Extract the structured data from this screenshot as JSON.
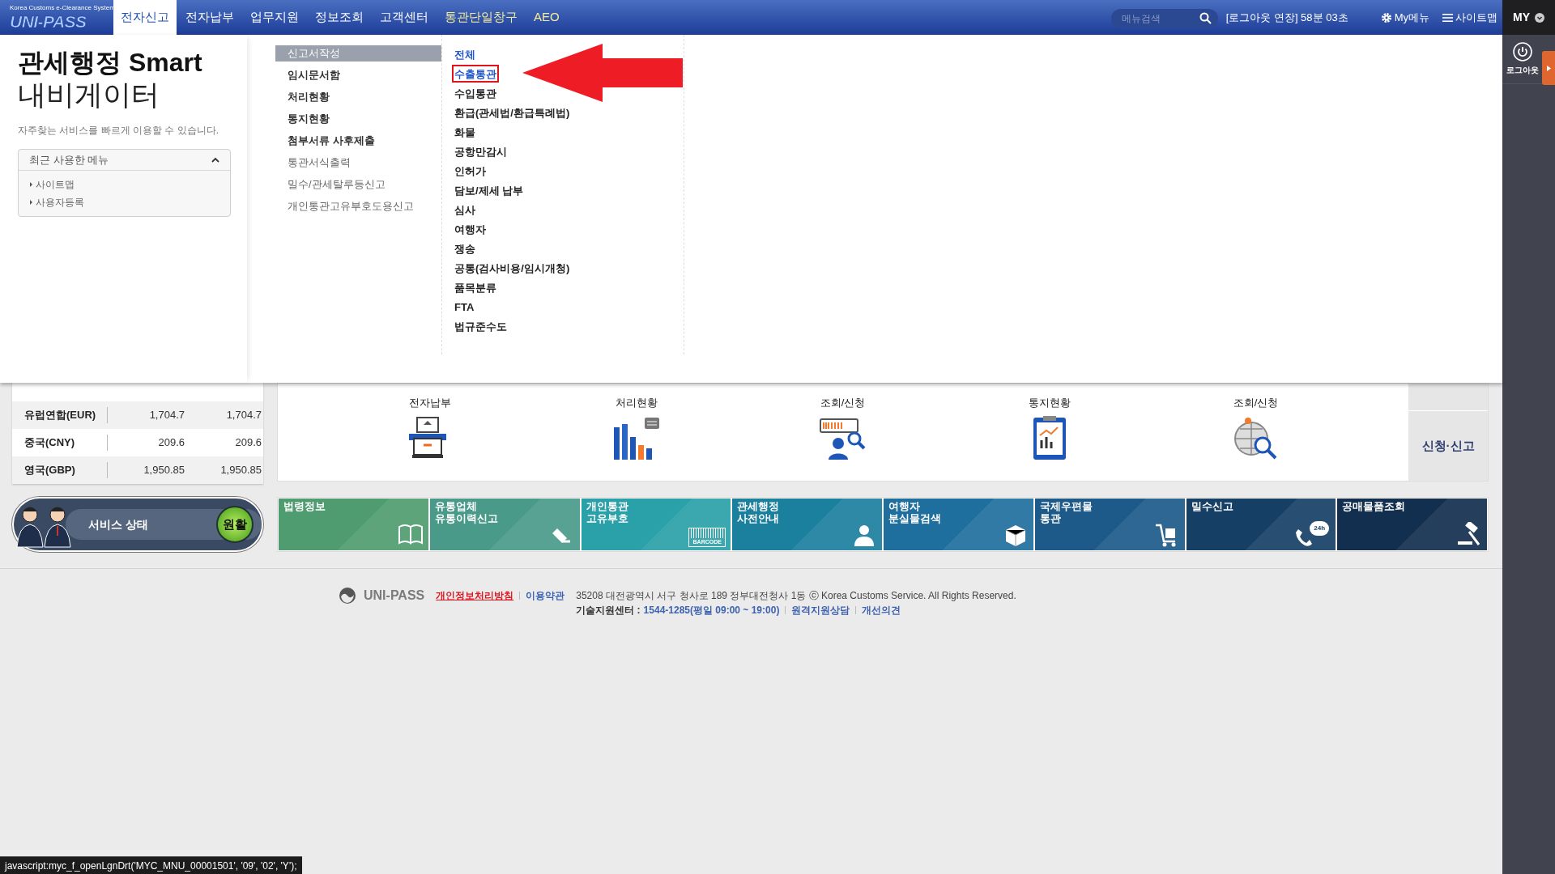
{
  "header": {
    "logo_tagline": "Korea Customs e-Clearance System",
    "logo": "UNI-PASS",
    "tabs": [
      {
        "label": "전자신고",
        "selected": true,
        "kind": "normal"
      },
      {
        "label": "전자납부",
        "selected": false,
        "kind": "normal"
      },
      {
        "label": "업무지원",
        "selected": false,
        "kind": "normal"
      },
      {
        "label": "정보조회",
        "selected": false,
        "kind": "normal"
      },
      {
        "label": "고객센터",
        "selected": false,
        "kind": "normal"
      },
      {
        "label": "통관단일창구",
        "selected": false,
        "kind": "highlight"
      },
      {
        "label": "AEO",
        "selected": false,
        "kind": "highlight"
      }
    ],
    "search": {
      "placeholder": "메뉴검색"
    },
    "session": "[로그아웃 연장] 58분 03초",
    "links": [
      {
        "label": "My메뉴",
        "kind": "gear"
      },
      {
        "label": "사이트맵",
        "kind": "menu"
      }
    ]
  },
  "right_rail": {
    "my": "MY",
    "logout": "로그아웃"
  },
  "navigator": {
    "title_bold": "관세행정 Smart",
    "title": "내비게이터",
    "description": "자주찾는 서비스를 빠르게 이용할 수 있습니다.",
    "recent": {
      "title": "최근 사용한 메뉴",
      "expanded": true,
      "items": [
        "사이트맵",
        "사용자등록"
      ]
    }
  },
  "menu": {
    "items": [
      {
        "label": "신고서작성",
        "selected": true,
        "emphasized": false
      },
      {
        "label": "임시문서함",
        "selected": false,
        "emphasized": true
      },
      {
        "label": "처리현황",
        "selected": false,
        "emphasized": true
      },
      {
        "label": "통지현황",
        "selected": false,
        "emphasized": true
      },
      {
        "label": "첨부서류 사후제출",
        "selected": false,
        "emphasized": true
      },
      {
        "label": "통관서식출력",
        "selected": false,
        "emphasized": false
      },
      {
        "label": "밀수/관세탈루등신고",
        "selected": false,
        "emphasized": false
      },
      {
        "label": "개인통관고유부호도용신고",
        "selected": false,
        "emphasized": false
      }
    ],
    "submenu": [
      {
        "label": "전체",
        "highlighted": true,
        "annotated": false
      },
      {
        "label": "수출통관",
        "highlighted": true,
        "annotated": true
      },
      {
        "label": "수입통관",
        "highlighted": false,
        "annotated": false
      },
      {
        "label": "환급(관세법/환급특례법)",
        "highlighted": false,
        "annotated": false
      },
      {
        "label": "화물",
        "highlighted": false,
        "annotated": false
      },
      {
        "label": "공항만감시",
        "highlighted": false,
        "annotated": false
      },
      {
        "label": "인허가",
        "highlighted": false,
        "annotated": false
      },
      {
        "label": "담보/제세 납부",
        "highlighted": false,
        "annotated": false
      },
      {
        "label": "심사",
        "highlighted": false,
        "annotated": false
      },
      {
        "label": "여행자",
        "highlighted": false,
        "annotated": false
      },
      {
        "label": "쟁송",
        "highlighted": false,
        "annotated": false
      },
      {
        "label": "공통(검사비용/임시개청)",
        "highlighted": false,
        "annotated": false
      },
      {
        "label": "품목분류",
        "highlighted": false,
        "annotated": false
      },
      {
        "label": "FTA",
        "highlighted": false,
        "annotated": false
      },
      {
        "label": "법규준수도",
        "highlighted": false,
        "annotated": false
      }
    ]
  },
  "exchange_rates": [
    {
      "currency": "유럽연합(EUR)",
      "values": [
        "1,704.7",
        "1,704.7"
      ]
    },
    {
      "currency": "중국(CNY)",
      "values": [
        "209.6",
        "209.6"
      ]
    },
    {
      "currency": "영국(GBP)",
      "values": [
        "1,950.85",
        "1,950.85"
      ]
    }
  ],
  "service_status": {
    "label": "서비스 상태",
    "status": "원활"
  },
  "quick_services": [
    {
      "label": "전자납부",
      "kind": "payment"
    },
    {
      "label": "처리현황",
      "kind": "chart"
    },
    {
      "label": "조회/신청",
      "kind": "barcode"
    },
    {
      "label": "통지현황",
      "kind": "report"
    },
    {
      "label": "조회/신청",
      "kind": "globe"
    }
  ],
  "side_tab": "신청·신고",
  "tiles": [
    {
      "lines": [
        "법령정보"
      ],
      "color": "#4f9c70",
      "kind": "book"
    },
    {
      "lines": [
        "유통업체",
        "유통이력신고"
      ],
      "color": "#4a9a8a",
      "kind": "pen"
    },
    {
      "lines": [
        "개인통관",
        "고유부호"
      ],
      "color": "#2aa0a8",
      "kind": "barcode"
    },
    {
      "lines": [
        "관세행정",
        "사전안내"
      ],
      "color": "#1b7f9e",
      "kind": "person"
    },
    {
      "lines": [
        "여행자",
        "분실물검색"
      ],
      "color": "#1f6f9e",
      "kind": "box"
    },
    {
      "lines": [
        "국제우편물",
        "통관"
      ],
      "color": "#1d5a8a",
      "kind": "cart"
    },
    {
      "lines": [
        "밀수신고"
      ],
      "color": "#163f66",
      "kind": "phone"
    },
    {
      "lines": [
        "공매물품조회"
      ],
      "color": "#122f4f",
      "kind": "gavel"
    }
  ],
  "barcode_label": "BARCODE",
  "phone_badge": "24h",
  "footer": {
    "brand": "UNI-PASS",
    "links": [
      {
        "label": "개인정보처리방침",
        "kind": "privacy"
      },
      {
        "label": "이용약관",
        "kind": "normal"
      }
    ],
    "address": "35208 대전광역시 서구 청사로 189 정부대전청사 1동 ⓒ Korea Customs Service. All Rights Reserved.",
    "support_label": "기술지원센터 :",
    "support_number": "1544-1285(평일 09:00 ~ 19:00)",
    "support_links": [
      "원격지원상담",
      "개선의견"
    ]
  },
  "status_bar": "javascript:myc_f_openLgnDrt('MYC_MNU_00001501', '09', '02', 'Y');"
}
